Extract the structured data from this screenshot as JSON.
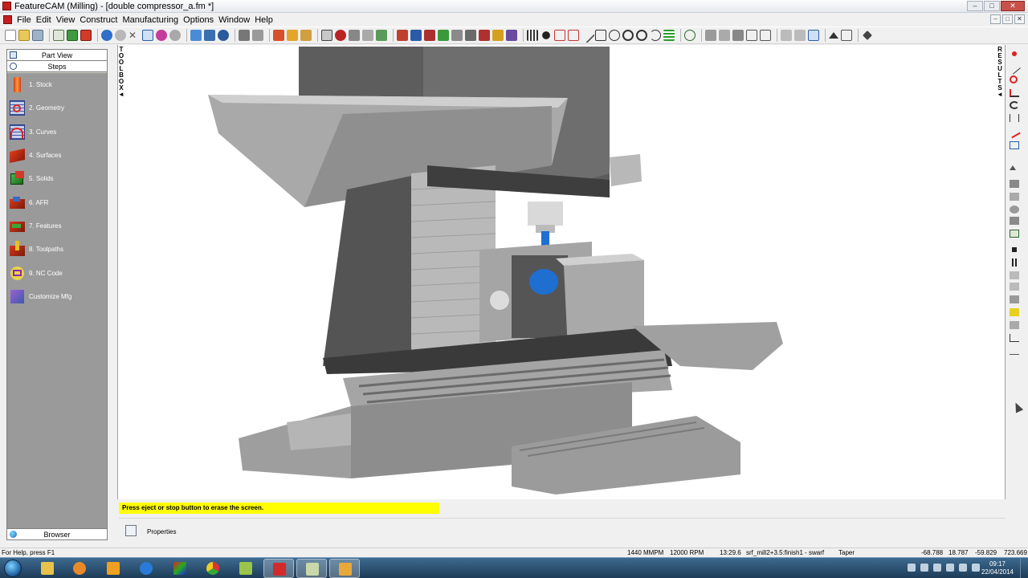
{
  "window": {
    "title": "FeatureCAM (Milling) - [double compressor_a.fm *]",
    "controls": [
      "–",
      "□",
      "✕"
    ]
  },
  "menu": [
    "File",
    "Edit",
    "View",
    "Construct",
    "Manufacturing",
    "Options",
    "Window",
    "Help"
  ],
  "left_panel": {
    "part_view": "Part View",
    "steps_header": "Steps",
    "steps": [
      {
        "label": "1. Stock",
        "icon": "stock-icon"
      },
      {
        "label": "2. Geometry",
        "icon": "geometry-icon"
      },
      {
        "label": "3. Curves",
        "icon": "curves-icon"
      },
      {
        "label": "4. Surfaces",
        "icon": "surfaces-icon"
      },
      {
        "label": "5. Solids",
        "icon": "solids-icon"
      },
      {
        "label": "6. AFR",
        "icon": "afr-icon"
      },
      {
        "label": "7. Features",
        "icon": "features-icon"
      },
      {
        "label": "8. Toolpaths",
        "icon": "toolpaths-icon"
      },
      {
        "label": "9. NC Code",
        "icon": "nc-code-icon"
      },
      {
        "label": "Customize Mfg",
        "icon": "customize-mfg-icon"
      }
    ],
    "browser": "Browser"
  },
  "toolbox_tab": [
    "T",
    "O",
    "O",
    "L",
    "B",
    "O",
    "X",
    "◄"
  ],
  "results_tab": [
    "R",
    "E",
    "S",
    "U",
    "L",
    "T",
    "S",
    "◄"
  ],
  "message": "Press eject or stop button to erase the screen.",
  "properties_label": "Properties",
  "status": {
    "help": "For Help, press F1",
    "feed": "1440 MMPM",
    "rpm": "12000 RPM",
    "time": "13:29.6",
    "operation": "srf_mill2+3.5:finish1 - swarf",
    "tool": "Taper",
    "x": "-68.788",
    "y": "18.787",
    "z": "-59.829",
    "extra": "723.669"
  },
  "taskbar": {
    "time": "09:17",
    "date": "22/04/2014"
  },
  "colors": {
    "machine_light": "#a8a8a8",
    "machine_mid": "#8a8a8a",
    "machine_dark": "#545454",
    "part_blue": "#1f6fd1",
    "message_bg": "#ffff00"
  }
}
